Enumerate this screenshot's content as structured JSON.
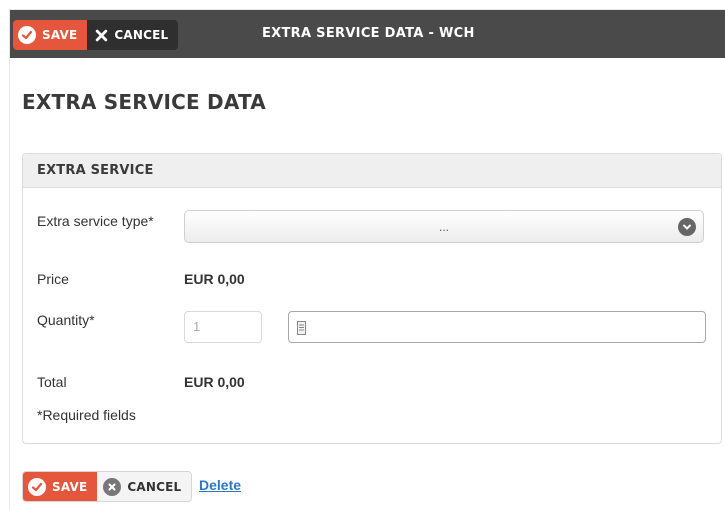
{
  "toolbar": {
    "save_label": "SAVE",
    "cancel_label": "CANCEL",
    "window_title": "EXTRA SERVICE DATA - WCH"
  },
  "page": {
    "title": "EXTRA SERVICE DATA"
  },
  "panel": {
    "header": "EXTRA SERVICE",
    "fields": {
      "service_type_label": "Extra service type*",
      "service_type_value": "...",
      "price_label": "Price",
      "price_value": "EUR 0,00",
      "quantity_label": "Quantity*",
      "quantity_placeholder": "1",
      "total_label": "Total",
      "total_value": "EUR 0,00"
    },
    "required_note": "*Required fields"
  },
  "footer": {
    "save_label": "SAVE",
    "cancel_label": "CANCEL",
    "delete_label": "Delete"
  },
  "colors": {
    "accent": "#e4573d",
    "topbar": "#4a4a4a",
    "link": "#2b78c5"
  },
  "icons": {
    "save": "check-circle-icon",
    "cancel_top": "x-icon",
    "cancel_bottom": "x-circle-icon",
    "select": "chevron-down-icon",
    "unit_field": "document-icon"
  }
}
